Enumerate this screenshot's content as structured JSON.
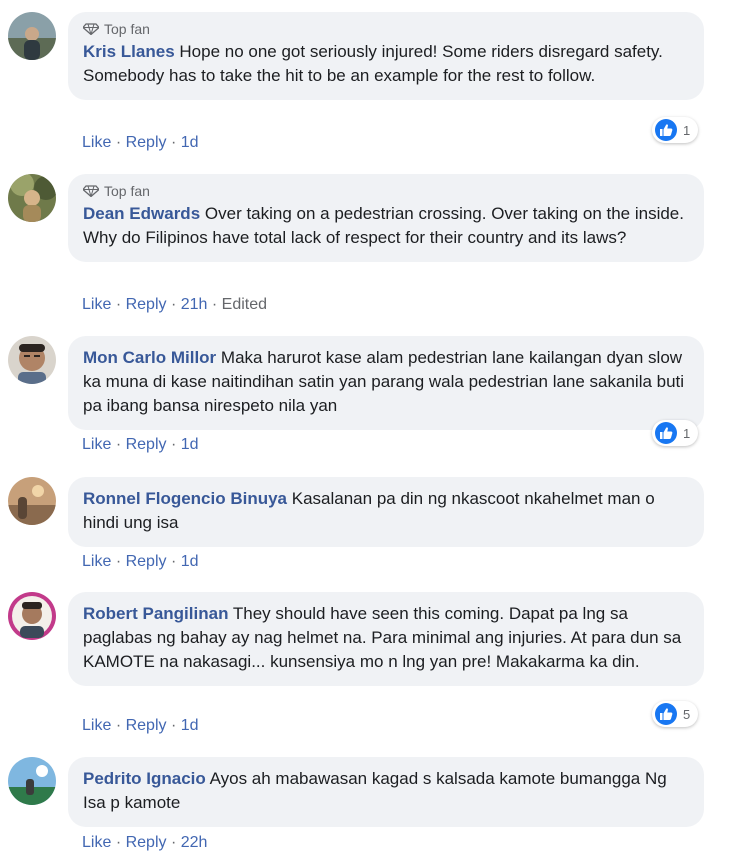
{
  "labels": {
    "top_fan": "Top fan",
    "like": "Like",
    "reply": "Reply",
    "dot": "·"
  },
  "colors": {
    "author": "#385898",
    "link": "#4267b2",
    "bubble": "#f0f2f5",
    "like_blue": "#1877f2"
  },
  "icons": {
    "top_fan": "diamond-icon",
    "reaction": "like-thumb-icon"
  },
  "comments": [
    {
      "author": "Kris Llanes",
      "top_fan": true,
      "text": "Hope no one got seriously injured! Some riders disregard safety. Somebody has to take the hit to be an example for the rest to follow.",
      "time": "1d",
      "reactions": "1"
    },
    {
      "author": "Dean Edwards",
      "top_fan": true,
      "text": "Over taking on a pedestrian crossing. Over taking on the inside. Why do Filipinos have total lack of respect for their country and its laws?",
      "time": "21h",
      "edited": "Edited"
    },
    {
      "author": "Mon Carlo Millor",
      "top_fan": false,
      "text": "Maka harurot kase alam pedestrian lane kailangan dyan slow ka muna di kase naitindihan satin yan parang wala pedestrian lane sakanila buti pa ibang bansa nirespeto nila yan",
      "time": "1d",
      "reactions": "1"
    },
    {
      "author": "Ronnel Flogencio Binuya",
      "top_fan": false,
      "text": "Kasalanan pa din ng nkascoot nkahelmet man o hindi ung isa",
      "time": "1d"
    },
    {
      "author": "Robert Pangilinan",
      "top_fan": false,
      "text": "They should have seen this coming. Dapat pa lng sa paglabas ng bahay ay nag helmet na. Para minimal ang injuries. At para dun sa KAMOTE na nakasagi... kunsensiya mo n lng yan pre! Makakarma ka din.",
      "time": "1d",
      "reactions": "5"
    },
    {
      "author": "Pedrito Ignacio",
      "top_fan": false,
      "text": "Ayos ah mabawasan kagad s kalsada kamote bumangga Ng Isa p kamote",
      "time": "22h"
    }
  ]
}
